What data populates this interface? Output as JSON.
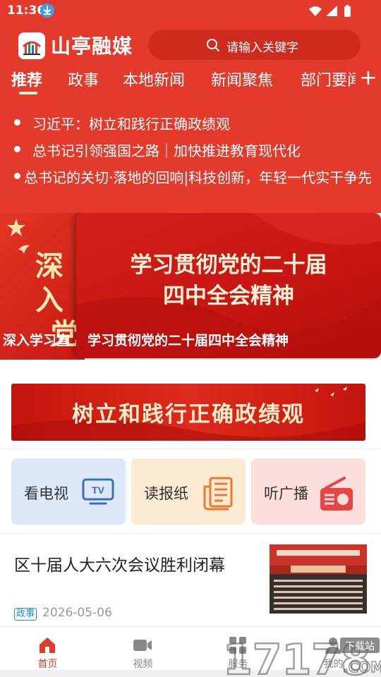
{
  "status_bar": {
    "time": "11:36"
  },
  "header": {
    "app_title": "山亭融媒",
    "search_placeholder": "请输入关键字"
  },
  "tabs": [
    {
      "label": "推荐",
      "active": true
    },
    {
      "label": "政事"
    },
    {
      "label": "本地新闻"
    },
    {
      "label": "新闻聚焦"
    },
    {
      "label": "部门要闻"
    }
  ],
  "tab_more_label": "+",
  "headlines": [
    "习近平：树立和践行正确政绩观",
    "总书记引领强国之路｜加快推进教育现代化",
    "总书记的关切·落地的回响|科技创新，年轻一代实干争先"
  ],
  "carousel": {
    "slides": [
      {
        "title_lines": [
          "深入",
          "党"
        ],
        "caption": "深入学习宣"
      },
      {
        "title_lines": [
          "学习贯彻党的二十届",
          "四中全会精神"
        ],
        "caption": "学习贯彻党的二十届四中全会精神"
      }
    ]
  },
  "banner": {
    "text": "树立和践行正确政绩观"
  },
  "quick_cards": [
    {
      "label": "看电视",
      "icon": "tv-icon",
      "color": "#3a6fc4"
    },
    {
      "label": "读报纸",
      "icon": "newspaper-icon",
      "color": "#f0772e"
    },
    {
      "label": "听广播",
      "icon": "radio-icon",
      "color": "#e54543"
    }
  ],
  "news": [
    {
      "title": "区十届人大六次会议胜利闭幕",
      "tag": "政事",
      "date": "2026-05-06"
    }
  ],
  "bottom_nav": [
    {
      "label": "首页",
      "icon": "home-icon",
      "active": true
    },
    {
      "label": "视频",
      "icon": "video-icon"
    },
    {
      "label": "服务",
      "icon": "service-icon"
    },
    {
      "label": "我的",
      "icon": "user-icon"
    }
  ],
  "watermark": {
    "text": "17178",
    "sub": "下载站",
    "suffix": ".COM"
  },
  "colors": {
    "brand_red": "#e43a2b",
    "active_nav": "#e43a2b"
  }
}
